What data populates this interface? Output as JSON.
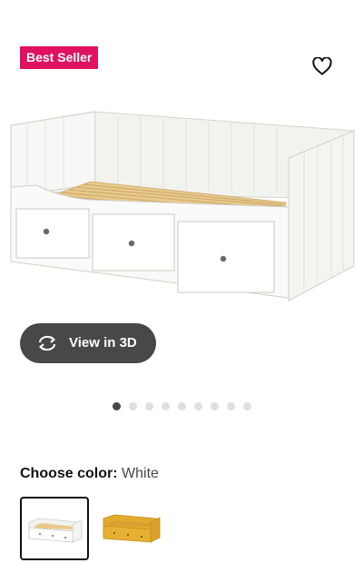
{
  "product": {
    "badge": "Best Seller",
    "image_icon": "daybed-product-image",
    "favorite_icon": "heart-outline-icon",
    "view3d_label": "View in 3D",
    "view3d_icon": "rotate-3d-icon"
  },
  "carousel": {
    "total": 9,
    "active_index": 0
  },
  "color": {
    "label": "Choose color:",
    "selected": "White",
    "swatches": [
      {
        "name": "white-daybed-swatch",
        "color": "#ffffff",
        "selected": true
      },
      {
        "name": "yellow-daybed-swatch",
        "color": "#e3ab2e",
        "selected": false
      }
    ]
  },
  "colors": {
    "badge": "#e0115f",
    "button": "#484848",
    "dot_active": "#484848",
    "dot_inactive": "#dfdfdf"
  }
}
